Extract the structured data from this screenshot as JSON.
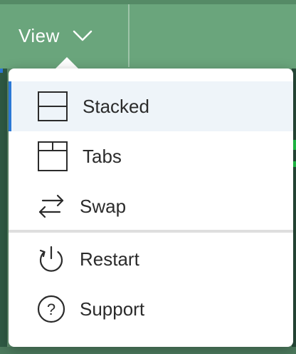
{
  "toolbar": {
    "view_label": "View"
  },
  "view_menu": {
    "items": [
      {
        "label": "Stacked",
        "icon": "stacked-layout-icon",
        "selected": true
      },
      {
        "label": "Tabs",
        "icon": "tabs-layout-icon",
        "selected": false
      },
      {
        "label": "Swap",
        "icon": "swap-arrows-icon",
        "selected": false
      },
      {
        "label": "Restart",
        "icon": "restart-power-icon",
        "selected": false
      },
      {
        "label": "Support",
        "icon": "question-circle-icon",
        "selected": false
      }
    ]
  },
  "colors": {
    "toolbar_bg": "#6aa57c",
    "selection_accent": "#2b78d6",
    "selection_bg": "#eef4f9",
    "menu_text": "#2b2b2b"
  }
}
